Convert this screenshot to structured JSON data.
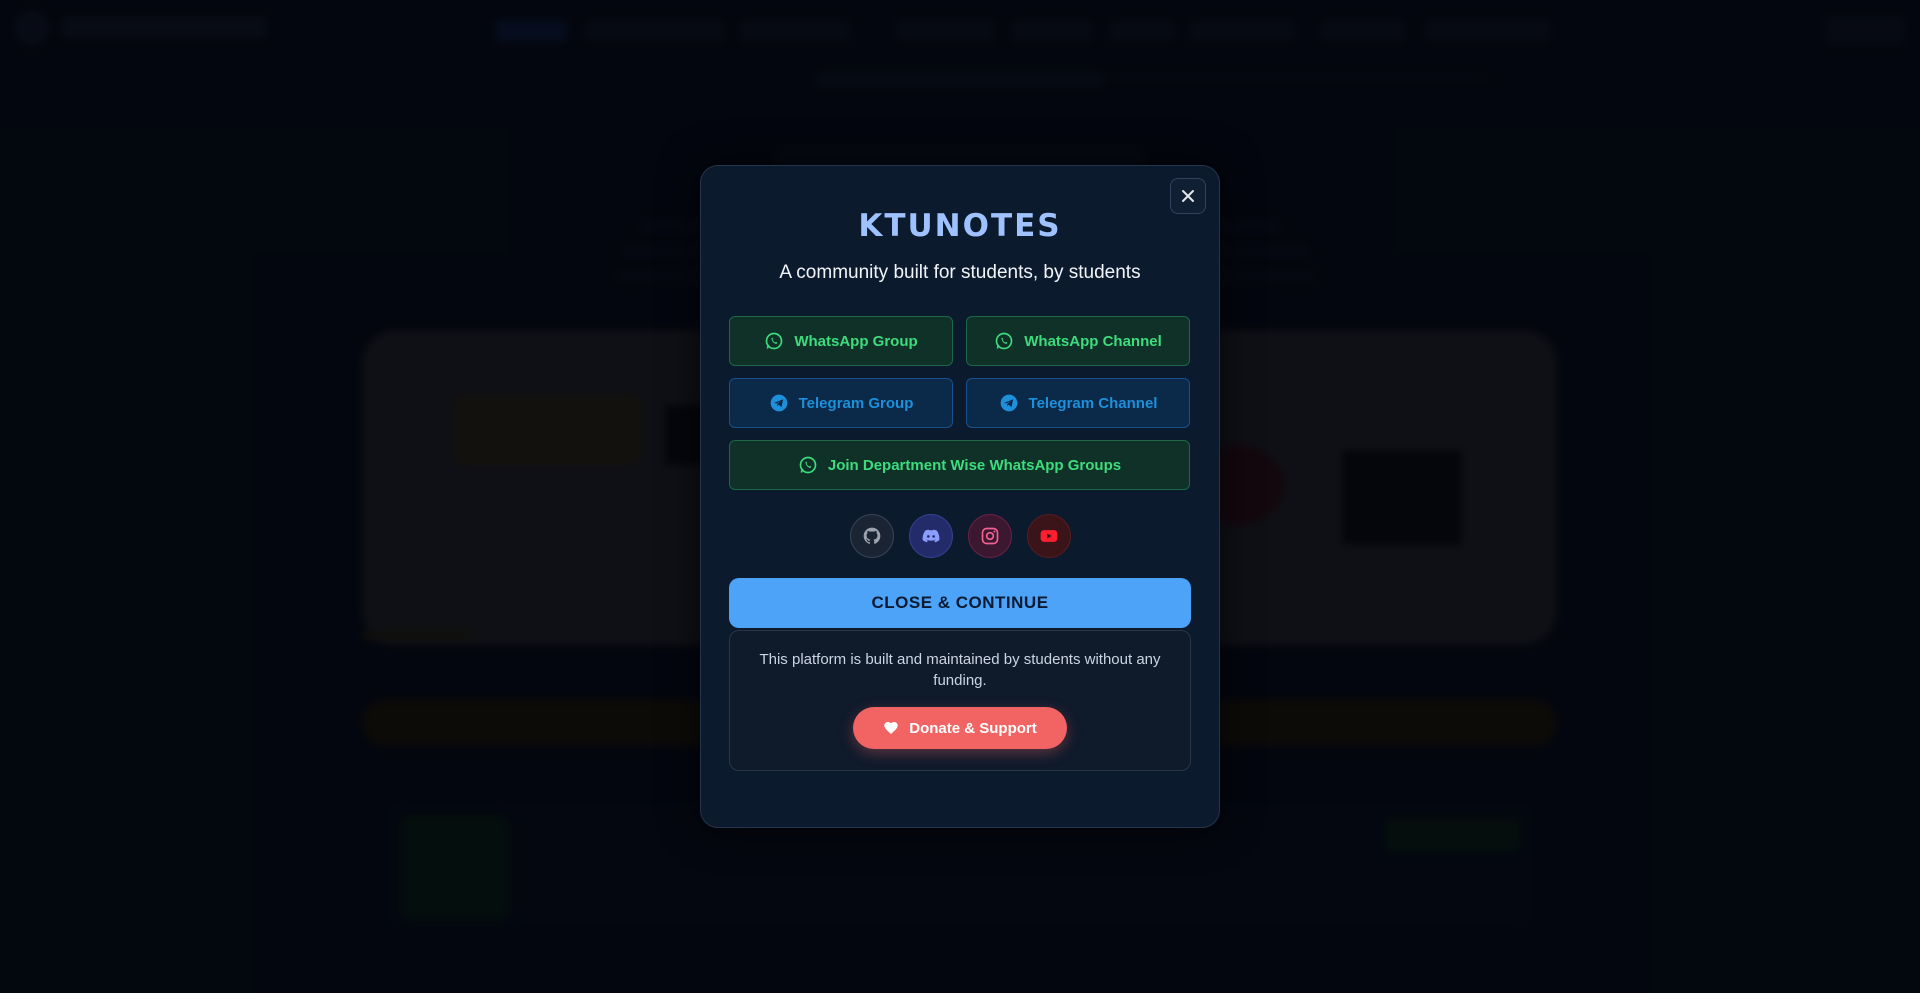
{
  "modal": {
    "title": "KTUNOTES",
    "subtitle": "A community built for students, by students",
    "close_icon": "close-icon",
    "links": [
      {
        "label": "WhatsApp Group",
        "icon": "whatsapp-icon"
      },
      {
        "label": "WhatsApp Channel",
        "icon": "whatsapp-icon"
      },
      {
        "label": "Telegram Group",
        "icon": "telegram-icon"
      },
      {
        "label": "Telegram Channel",
        "icon": "telegram-icon"
      },
      {
        "label": "Join Department Wise WhatsApp Groups",
        "icon": "whatsapp-icon"
      }
    ],
    "socials": [
      "github-icon",
      "discord-icon",
      "instagram-icon",
      "youtube-icon"
    ],
    "continue_label": "CLOSE & CONTINUE",
    "donate_text": "This platform is built and maintained by students without any funding.",
    "donate_label": "Donate & Support"
  },
  "colors": {
    "accent": "#4da3f7",
    "title": "#9fc2ff",
    "whatsapp": "#3ddc7d",
    "telegram": "#1e8fdb",
    "donate": "#f26464"
  }
}
